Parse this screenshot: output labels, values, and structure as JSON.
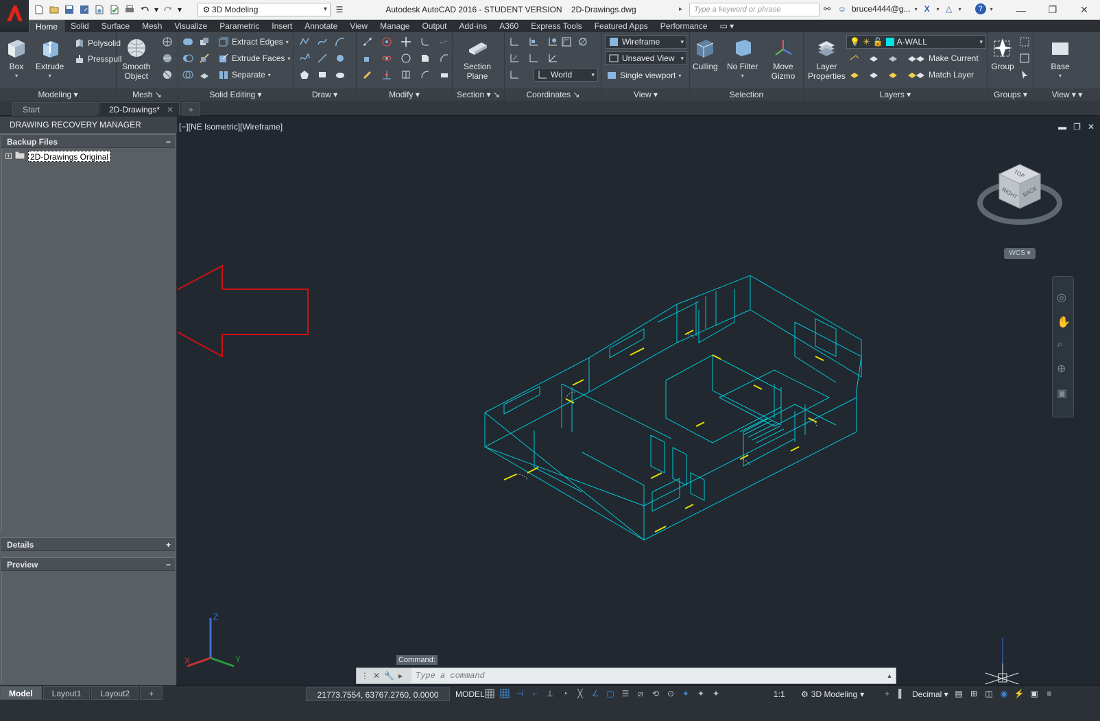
{
  "title_bar": {
    "workspace": "3D Modeling",
    "app_title": "Autodesk AutoCAD 2016 - STUDENT VERSION",
    "file_name": "2D-Drawings.dwg",
    "search_placeholder": "Type a keyword or phrase",
    "user": "bruce4444@g..."
  },
  "ribbon_tabs": [
    "Home",
    "Solid",
    "Surface",
    "Mesh",
    "Visualize",
    "Parametric",
    "Insert",
    "Annotate",
    "View",
    "Manage",
    "Output",
    "Add-ins",
    "A360",
    "Express Tools",
    "Featured Apps",
    "Performance"
  ],
  "ribbon": {
    "modeling": {
      "title": "Modeling",
      "box": "Box",
      "extrude": "Extrude",
      "polysolid": "Polysolid",
      "presspull": "Presspull"
    },
    "mesh": {
      "title": "Mesh",
      "smooth_l1": "Smooth",
      "smooth_l2": "Object"
    },
    "solid_editing": {
      "title": "Solid Editing",
      "extract_edges": "Extract Edges",
      "extrude_faces": "Extrude Faces",
      "separate": "Separate"
    },
    "draw": {
      "title": "Draw"
    },
    "modify": {
      "title": "Modify"
    },
    "section": {
      "title": "Section",
      "plane_l1": "Section",
      "plane_l2": "Plane"
    },
    "coordinates": {
      "title": "Coordinates",
      "world": "World"
    },
    "view": {
      "title": "View",
      "visual_style": "Wireframe",
      "saved_view": "Unsaved View",
      "viewport": "Single viewport"
    },
    "selection": {
      "title": "Selection",
      "culling": "Culling",
      "no_filter": "No Filter",
      "move_l1": "Move",
      "move_l2": "Gizmo"
    },
    "layers": {
      "title": "Layers",
      "props_l1": "Layer",
      "props_l2": "Properties",
      "current_layer": "A-WALL",
      "make_current": "Make Current",
      "match_layer": "Match Layer"
    },
    "groups": {
      "title": "Groups",
      "group": "Group"
    },
    "view2": {
      "title": "View",
      "base": "Base"
    }
  },
  "file_tabs": {
    "start": "Start",
    "drawing": "2D-Drawings*"
  },
  "recovery": {
    "title": "DRAWING RECOVERY MANAGER",
    "backup_files": "Backup Files",
    "backup_item": "2D-Drawings Original",
    "details": "Details",
    "preview": "Preview"
  },
  "viewport": {
    "label": "[−][NE Isometric][Wireframe]",
    "wcs": "WCS",
    "cube_top": "TOP",
    "cube_right": "RIGHT",
    "cube_back": "BACK",
    "axis_x": "X",
    "axis_y": "Y",
    "axis_z": "Z"
  },
  "command": {
    "label": "Command:",
    "placeholder": "Type a command"
  },
  "status": {
    "layouts": [
      "Model",
      "Layout1",
      "Layout2"
    ],
    "coords": "21773.7554, 63767.2760, 0.0000",
    "space": "MODEL",
    "scale": "1:1",
    "workspace": "3D Modeling",
    "units": "Decimal"
  },
  "colors": {
    "accent": "#00c8d4",
    "annotation_arrow": "#d01010",
    "yellow": "#e8e000",
    "layer_swatch": "#00e5e5"
  }
}
